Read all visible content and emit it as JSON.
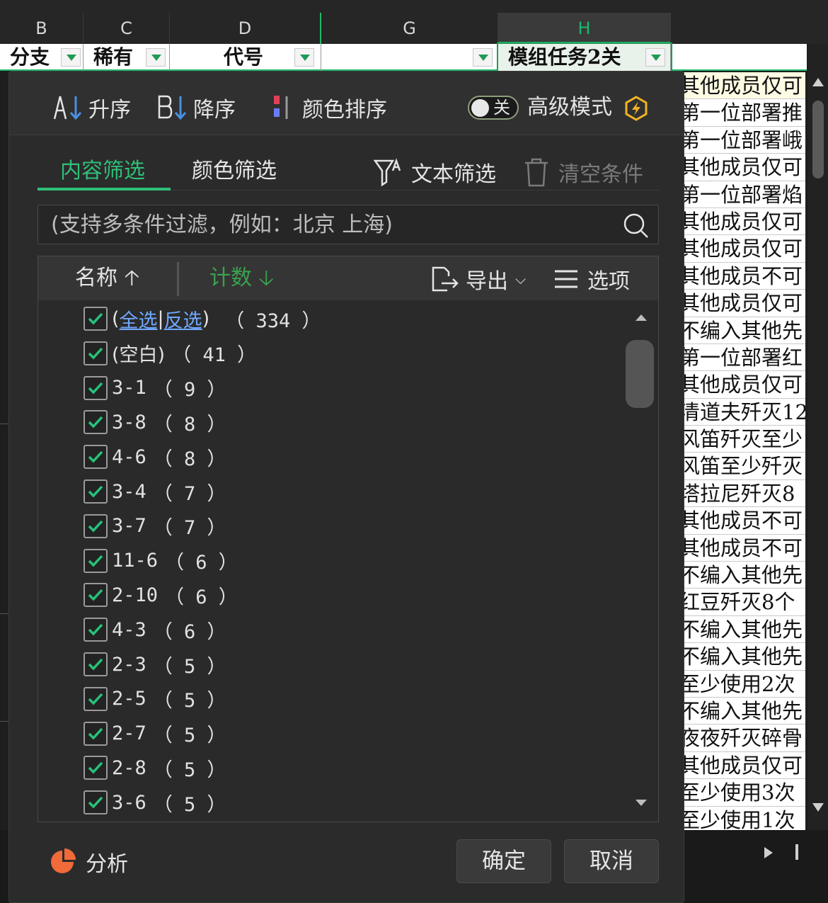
{
  "sheet": {
    "columns": [
      {
        "letter": "B"
      },
      {
        "letter": "C"
      },
      {
        "letter": "D"
      },
      {
        "letter": "G"
      },
      {
        "letter": "H"
      }
    ],
    "filter_row": {
      "b": "分支",
      "c": "稀有",
      "d": "代号",
      "g": "",
      "h": "模组任务2关"
    },
    "right_cells": [
      "其他成员仅可",
      "第一位部署推",
      "第一位部署峨",
      "其他成员仅可",
      "第一位部署焰",
      "其他成员仅可",
      "其他成员仅可",
      "其他成员不可",
      "其他成员仅可",
      "不编入其他先",
      "第一位部署红",
      "其他成员仅可",
      "清道夫歼灭12",
      "风笛歼灭至少",
      "风笛至少歼灭",
      "塔拉尼歼灭8",
      "其他成员不可",
      "其他成员不可",
      "不编入其他先",
      "红豆歼灭8个",
      "不编入其他先",
      "不编入其他先",
      "至少使用2次",
      "不编入其他先",
      "夜夜歼灭碎骨",
      "其他成员仅可",
      "至少使用3次",
      "至少使用1次"
    ]
  },
  "panel": {
    "sort_asc": "升序",
    "sort_desc": "降序",
    "color_sort": "颜色排序",
    "toggle_label": "关",
    "advanced_mode": "高级模式",
    "tab_content": "内容筛选",
    "tab_color": "颜色筛选",
    "text_filter": "文本筛选",
    "clear_conditions": "清空条件",
    "search_placeholder": "(支持多条件过滤，例如：北京 上海)",
    "list_header": {
      "name": "名称",
      "count": "计数",
      "export": "导出",
      "options": "选项"
    },
    "select_all": {
      "open": "(",
      "all": "全选",
      "sep": "|",
      "invert": "反选",
      "close": ")",
      "count": "（ 334 ）"
    },
    "items": [
      {
        "label": "(空白)",
        "count": "（ 41 ）"
      },
      {
        "label": "3-1",
        "count": "（ 9 ）"
      },
      {
        "label": "3-8",
        "count": "（ 8 ）"
      },
      {
        "label": "4-6",
        "count": "（ 8 ）"
      },
      {
        "label": "3-4",
        "count": "（ 7 ）"
      },
      {
        "label": "3-7",
        "count": "（ 7 ）"
      },
      {
        "label": "11-6",
        "count": "（ 6 ）"
      },
      {
        "label": "2-10",
        "count": "（ 6 ）"
      },
      {
        "label": "4-3",
        "count": "（ 6 ）"
      },
      {
        "label": "2-3",
        "count": "（ 5 ）"
      },
      {
        "label": "2-5",
        "count": "（ 5 ）"
      },
      {
        "label": "2-7",
        "count": "（ 5 ）"
      },
      {
        "label": "2-8",
        "count": "（ 5 ）"
      },
      {
        "label": "3-6",
        "count": "（ 5 ）"
      }
    ],
    "analysis": "分析",
    "ok": "确定",
    "cancel": "取消"
  },
  "colors": {
    "accent": "#2fbf78",
    "link": "#6fa8ff",
    "panel_bg": "#2b2b2b",
    "checkbox_check": "#27c27a",
    "analysis_icon": "#f06a3a",
    "advanced_badge": "#f0b323"
  }
}
